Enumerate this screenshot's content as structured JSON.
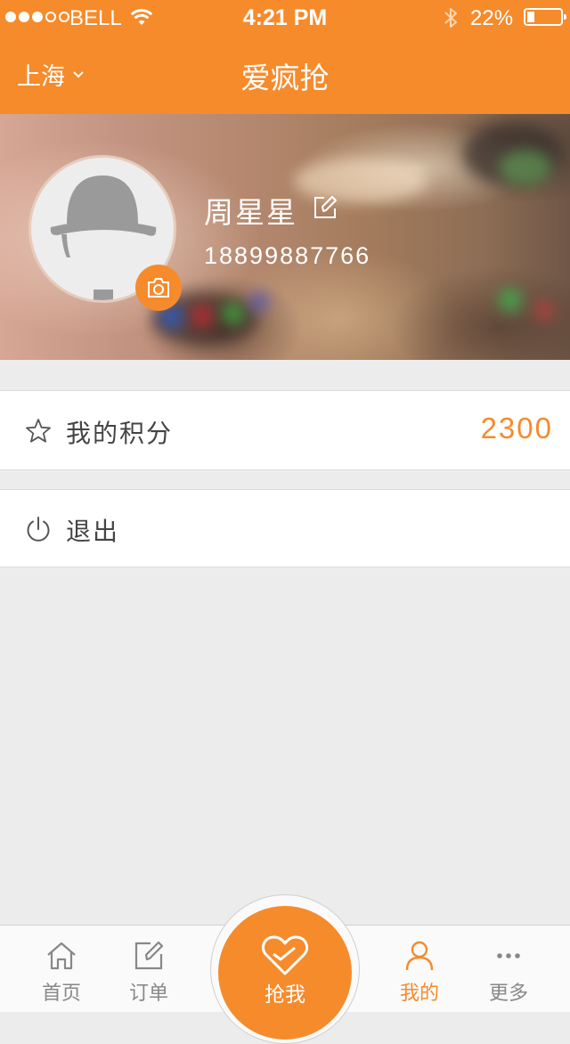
{
  "status_bar": {
    "carrier": "BELL",
    "time": "4:21 PM",
    "battery_percent": "22%",
    "battery_level": 0.22,
    "signal_bars_filled": 3,
    "signal_bars_total": 5
  },
  "nav": {
    "city": "上海",
    "title": "爱疯抢"
  },
  "profile": {
    "name": "周星星",
    "phone": "18899887766",
    "avatar_icon": "bowler-hat-icon",
    "camera_icon": "camera-icon",
    "edit_icon": "edit-icon"
  },
  "rows": {
    "points": {
      "icon": "star-icon",
      "label": "我的积分",
      "value": "2300"
    },
    "logout": {
      "icon": "power-icon",
      "label": "退出"
    }
  },
  "tab_bar": {
    "home": {
      "label": "首页",
      "icon": "home-icon"
    },
    "orders": {
      "label": "订单",
      "icon": "edit-square-icon"
    },
    "grab": {
      "label": "抢我",
      "icon": "heart-icon"
    },
    "mine": {
      "label": "我的",
      "icon": "person-icon",
      "active": true
    },
    "more": {
      "label": "更多",
      "icon": "ellipsis-icon"
    }
  },
  "colors": {
    "accent": "#f68b2c",
    "background": "#ececec",
    "tab_inactive": "#888888"
  }
}
